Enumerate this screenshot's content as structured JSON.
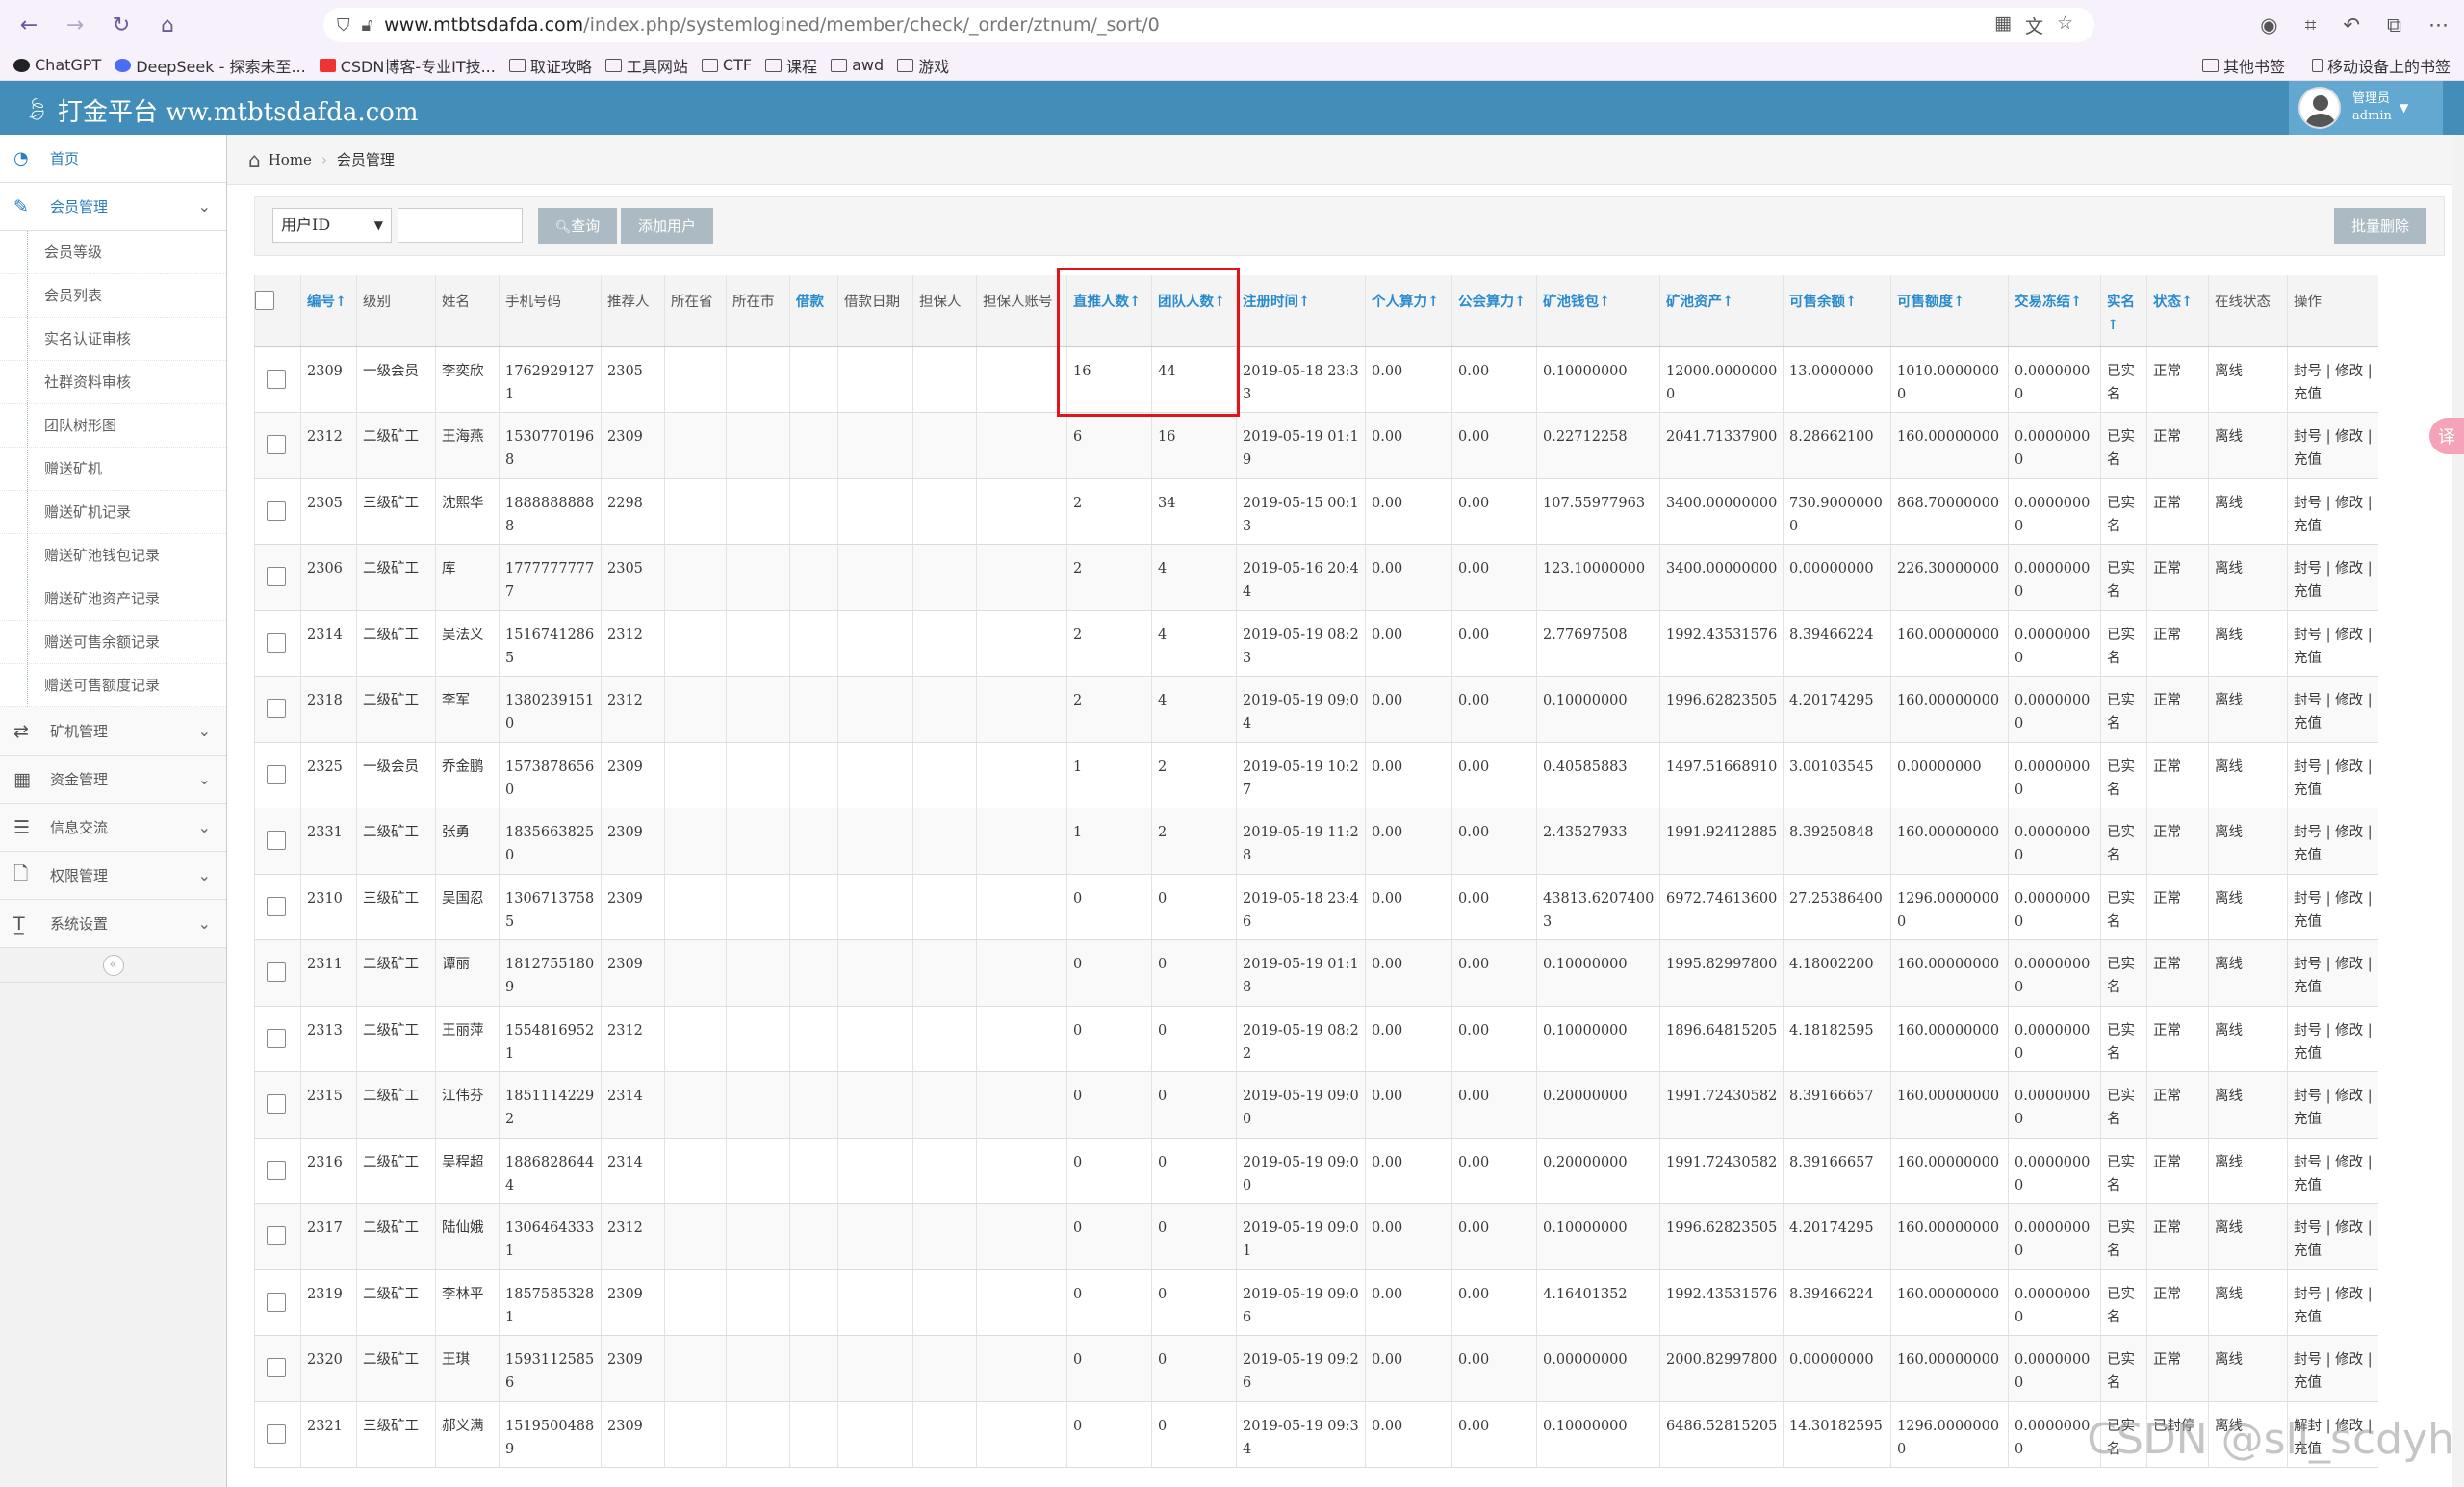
{
  "browser": {
    "url_domain": "www.mtbtsdafda.com",
    "url_path": "/index.php/systemlogined/member/check/_order/ztnum/_sort/0",
    "bookmarks": [
      "ChatGPT",
      "DeepSeek - 探索未至...",
      "CSDN博客-专业IT技...",
      "取证攻略",
      "工具网站",
      "CTF",
      "课程",
      "awd",
      "游戏"
    ],
    "bookmarks_right": [
      "其他书签",
      "移动设备上的书签"
    ]
  },
  "header": {
    "brand": "打金平台 ww.mtbtsdafda.com",
    "user_role": "管理员",
    "user_name": "admin"
  },
  "sidebar": {
    "home": "首页",
    "member_section": "会员管理",
    "member_items": [
      "会员等级",
      "会员列表",
      "实名认证审核",
      "社群资料审核",
      "团队树形图",
      "赠送矿机",
      "赠送矿机记录",
      "赠送矿池钱包记录",
      "赠送矿池资产记录",
      "赠送可售余额记录",
      "赠送可售额度记录"
    ],
    "sections": [
      {
        "label": "矿机管理",
        "icon": "shuffle-icon"
      },
      {
        "label": "资金管理",
        "icon": "calendar-icon"
      },
      {
        "label": "信息交流",
        "icon": "list-icon"
      },
      {
        "label": "权限管理",
        "icon": "file-icon"
      },
      {
        "label": "系统设置",
        "icon": "text-icon"
      }
    ]
  },
  "breadcrumb": {
    "home": "Home",
    "current": "会员管理"
  },
  "search": {
    "select_value": "用户ID",
    "query_button": "查询",
    "add_button": "添加用户",
    "batch_delete": "批量删除"
  },
  "table": {
    "headers": [
      "编号↑",
      "级别",
      "姓名",
      "手机号码",
      "推荐人",
      "所在省",
      "所在市",
      "借款",
      "借款日期",
      "担保人",
      "担保人账号",
      "直推人数↑",
      "团队人数↑",
      "注册时间↑",
      "个人算力↑",
      "公会算力↑",
      "矿池钱包↑",
      "矿池资产↑",
      "可售余额↑",
      "可售额度↑",
      "交易冻结↑",
      "实名↑",
      "状态↑",
      "在线状态",
      "操作"
    ],
    "rows": [
      [
        "2309",
        "一级会员",
        "李奕欣",
        "17629291271",
        "2305",
        "",
        "",
        "",
        "",
        "",
        "",
        "16",
        "44",
        "2019-05-18 23:33",
        "0.00",
        "0.00",
        "0.10000000",
        "12000.00000000",
        "13.0000000",
        "1010.00000000",
        "0.00000000",
        "已实名",
        "正常",
        "离线",
        "封号 | 修改 | 充值"
      ],
      [
        "2312",
        "二级矿工",
        "王海燕",
        "15307701968",
        "2309",
        "",
        "",
        "",
        "",
        "",
        "",
        "6",
        "16",
        "2019-05-19 01:19",
        "0.00",
        "0.00",
        "0.22712258",
        "2041.71337900",
        "8.28662100",
        "160.00000000",
        "0.00000000",
        "已实名",
        "正常",
        "离线",
        "封号 | 修改 | 充值"
      ],
      [
        "2305",
        "三级矿工",
        "沈熙华",
        "18888888888",
        "2298",
        "",
        "",
        "",
        "",
        "",
        "",
        "2",
        "34",
        "2019-05-15 00:13",
        "0.00",
        "0.00",
        "107.55977963",
        "3400.00000000",
        "730.90000000",
        "868.70000000",
        "0.00000000",
        "已实名",
        "正常",
        "离线",
        "封号 | 修改 | 充值"
      ],
      [
        "2306",
        "二级矿工",
        "库",
        "17777777777",
        "2305",
        "",
        "",
        "",
        "",
        "",
        "",
        "2",
        "4",
        "2019-05-16 20:44",
        "0.00",
        "0.00",
        "123.10000000",
        "3400.00000000",
        "0.00000000",
        "226.30000000",
        "0.00000000",
        "已实名",
        "正常",
        "离线",
        "封号 | 修改 | 充值"
      ],
      [
        "2314",
        "二级矿工",
        "吴法义",
        "15167412865",
        "2312",
        "",
        "",
        "",
        "",
        "",
        "",
        "2",
        "4",
        "2019-05-19 08:23",
        "0.00",
        "0.00",
        "2.77697508",
        "1992.43531576",
        "8.39466224",
        "160.00000000",
        "0.00000000",
        "已实名",
        "正常",
        "离线",
        "封号 | 修改 | 充值"
      ],
      [
        "2318",
        "二级矿工",
        "李军",
        "13802391510",
        "2312",
        "",
        "",
        "",
        "",
        "",
        "",
        "2",
        "4",
        "2019-05-19 09:04",
        "0.00",
        "0.00",
        "0.10000000",
        "1996.62823505",
        "4.20174295",
        "160.00000000",
        "0.00000000",
        "已实名",
        "正常",
        "离线",
        "封号 | 修改 | 充值"
      ],
      [
        "2325",
        "一级会员",
        "乔金鹏",
        "15738786560",
        "2309",
        "",
        "",
        "",
        "",
        "",
        "",
        "1",
        "2",
        "2019-05-19 10:27",
        "0.00",
        "0.00",
        "0.40585883",
        "1497.51668910",
        "3.00103545",
        "0.00000000",
        "0.00000000",
        "已实名",
        "正常",
        "离线",
        "封号 | 修改 | 充值"
      ],
      [
        "2331",
        "二级矿工",
        "张勇",
        "18356638250",
        "2309",
        "",
        "",
        "",
        "",
        "",
        "",
        "1",
        "2",
        "2019-05-19 11:28",
        "0.00",
        "0.00",
        "2.43527933",
        "1991.92412885",
        "8.39250848",
        "160.00000000",
        "0.00000000",
        "已实名",
        "正常",
        "离线",
        "封号 | 修改 | 充值"
      ],
      [
        "2310",
        "三级矿工",
        "吴国忍",
        "13067137585",
        "2309",
        "",
        "",
        "",
        "",
        "",
        "",
        "0",
        "0",
        "2019-05-18 23:46",
        "0.00",
        "0.00",
        "43813.62074003",
        "6972.74613600",
        "27.25386400",
        "1296.00000000",
        "0.00000000",
        "已实名",
        "正常",
        "离线",
        "封号 | 修改 | 充值"
      ],
      [
        "2311",
        "二级矿工",
        "谭丽",
        "18127551809",
        "2309",
        "",
        "",
        "",
        "",
        "",
        "",
        "0",
        "0",
        "2019-05-19 01:18",
        "0.00",
        "0.00",
        "0.10000000",
        "1995.82997800",
        "4.18002200",
        "160.00000000",
        "0.00000000",
        "已实名",
        "正常",
        "离线",
        "封号 | 修改 | 充值"
      ],
      [
        "2313",
        "二级矿工",
        "王丽萍",
        "15548169521",
        "2312",
        "",
        "",
        "",
        "",
        "",
        "",
        "0",
        "0",
        "2019-05-19 08:22",
        "0.00",
        "0.00",
        "0.10000000",
        "1896.64815205",
        "4.18182595",
        "160.00000000",
        "0.00000000",
        "已实名",
        "正常",
        "离线",
        "封号 | 修改 | 充值"
      ],
      [
        "2315",
        "二级矿工",
        "江伟芬",
        "18511142292",
        "2314",
        "",
        "",
        "",
        "",
        "",
        "",
        "0",
        "0",
        "2019-05-19 09:00",
        "0.00",
        "0.00",
        "0.20000000",
        "1991.72430582",
        "8.39166657",
        "160.00000000",
        "0.00000000",
        "已实名",
        "正常",
        "离线",
        "封号 | 修改 | 充值"
      ],
      [
        "2316",
        "二级矿工",
        "吴程超",
        "18868286444",
        "2314",
        "",
        "",
        "",
        "",
        "",
        "",
        "0",
        "0",
        "2019-05-19 09:00",
        "0.00",
        "0.00",
        "0.20000000",
        "1991.72430582",
        "8.39166657",
        "160.00000000",
        "0.00000000",
        "已实名",
        "正常",
        "离线",
        "封号 | 修改 | 充值"
      ],
      [
        "2317",
        "二级矿工",
        "陆仙娥",
        "13064643331",
        "2312",
        "",
        "",
        "",
        "",
        "",
        "",
        "0",
        "0",
        "2019-05-19 09:01",
        "0.00",
        "0.00",
        "0.10000000",
        "1996.62823505",
        "4.20174295",
        "160.00000000",
        "0.00000000",
        "已实名",
        "正常",
        "离线",
        "封号 | 修改 | 充值"
      ],
      [
        "2319",
        "二级矿工",
        "李林平",
        "18575853281",
        "2309",
        "",
        "",
        "",
        "",
        "",
        "",
        "0",
        "0",
        "2019-05-19 09:06",
        "0.00",
        "0.00",
        "4.16401352",
        "1992.43531576",
        "8.39466224",
        "160.00000000",
        "0.00000000",
        "已实名",
        "正常",
        "离线",
        "封号 | 修改 | 充值"
      ],
      [
        "2320",
        "二级矿工",
        "王琪",
        "15931125856",
        "2309",
        "",
        "",
        "",
        "",
        "",
        "",
        "0",
        "0",
        "2019-05-19 09:26",
        "0.00",
        "0.00",
        "0.00000000",
        "2000.82997800",
        "0.00000000",
        "160.00000000",
        "0.00000000",
        "已实名",
        "正常",
        "离线",
        "封号 | 修改 | 充值"
      ],
      [
        "2321",
        "三级矿工",
        "郝义满",
        "15195004889",
        "2309",
        "",
        "",
        "",
        "",
        "",
        "",
        "0",
        "0",
        "2019-05-19 09:34",
        "0.00",
        "0.00",
        "0.10000000",
        "6486.52815205",
        "14.30182595",
        "1296.00000000",
        "0.00000000",
        "已实名",
        "已封停",
        "离线",
        "解封 | 修改 | 充值"
      ]
    ]
  },
  "watermark": "CSDN @sll_scdyh",
  "colors": {
    "header_bg": "#438eb9",
    "link": "#2a8bcc",
    "alert": "#d12610",
    "highlight_box": "#e4121b"
  }
}
